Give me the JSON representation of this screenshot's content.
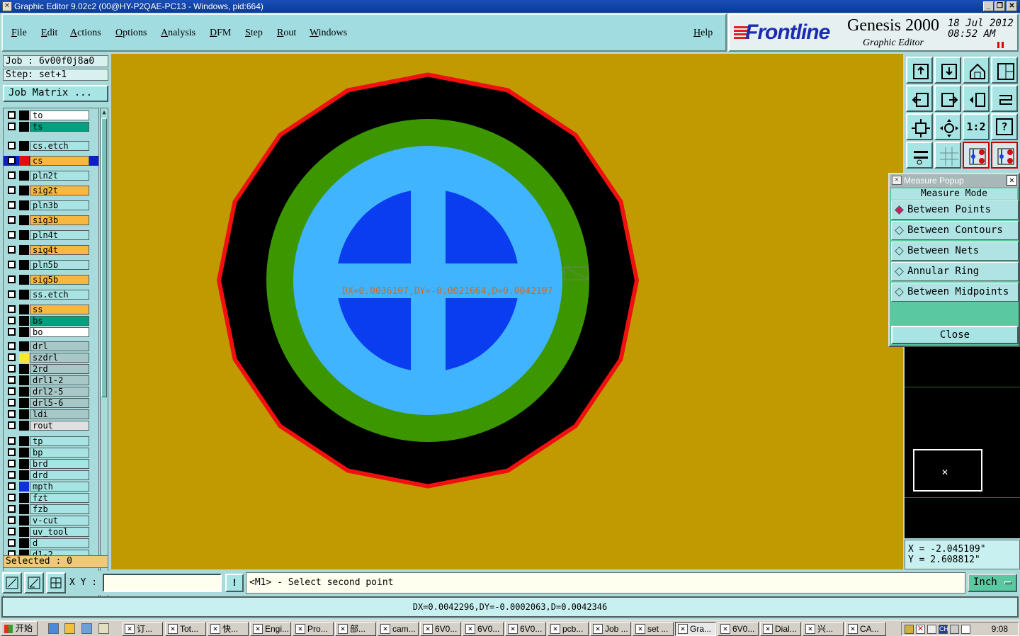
{
  "window": {
    "title": "Graphic Editor 9.02c2 (00@HY-P2QAE-PC13 - Windows, pid:664)",
    "minimize": "_",
    "maximize": "❐",
    "close": "✕"
  },
  "menu": {
    "items": [
      "File",
      "Edit",
      "Actions",
      "Options",
      "Analysis",
      "DFM",
      "Step",
      "Rout",
      "Windows"
    ],
    "help": "Help"
  },
  "brand": {
    "logo": "Frontline",
    "product": "Genesis 2000",
    "subtitle": "Graphic Editor",
    "date": "18 Jul 2012",
    "time": "08:52  AM"
  },
  "left": {
    "job": "Job : 6v00f0j8a0",
    "step": "Step: set+1",
    "job_matrix": "Job Matrix ...",
    "selected": "Selected : 0",
    "layers": [
      {
        "name": "to",
        "color": "#ffffff",
        "swatch": "#000000"
      },
      {
        "name": "ts",
        "color": "#00a080",
        "swatch": "#000000"
      },
      {
        "name": "cs.etch",
        "color": "#a8e4e4",
        "swatch": "#000000"
      },
      {
        "name": "cs",
        "color": "#f8b840",
        "swatch": "#e01010",
        "active": true
      },
      {
        "name": "pln2t",
        "color": "#a8e4e4",
        "swatch": "#000000"
      },
      {
        "name": "sig2t",
        "color": "#f8b840",
        "swatch": "#000000"
      },
      {
        "name": "pln3b",
        "color": "#a8e4e4",
        "swatch": "#000000"
      },
      {
        "name": "sig3b",
        "color": "#f8b840",
        "swatch": "#000000"
      },
      {
        "name": "pln4t",
        "color": "#a8e4e4",
        "swatch": "#000000"
      },
      {
        "name": "sig4t",
        "color": "#f8b840",
        "swatch": "#000000"
      },
      {
        "name": "pln5b",
        "color": "#a8e4e4",
        "swatch": "#000000"
      },
      {
        "name": "sig5b",
        "color": "#f8b840",
        "swatch": "#000000"
      },
      {
        "name": "ss.etch",
        "color": "#a8e4e4",
        "swatch": "#000000"
      },
      {
        "name": "ss",
        "color": "#f8b840",
        "swatch": "#000000"
      },
      {
        "name": "bs",
        "color": "#00a080",
        "swatch": "#000000"
      },
      {
        "name": "bo",
        "color": "#ffffff",
        "swatch": "#000000"
      },
      {
        "name": "drl",
        "color": "#a8c8c8",
        "swatch": "#000000"
      },
      {
        "name": "szdrl",
        "color": "#a8c8c8",
        "swatch": "#f8e830"
      },
      {
        "name": "2rd",
        "color": "#a8c8c8",
        "swatch": "#000000"
      },
      {
        "name": "drl1-2",
        "color": "#a8c8c8",
        "swatch": "#000000"
      },
      {
        "name": "drl2-5",
        "color": "#a8c8c8",
        "swatch": "#000000"
      },
      {
        "name": "drl5-6",
        "color": "#a8c8c8",
        "swatch": "#000000"
      },
      {
        "name": "ldi",
        "color": "#a8c8c8",
        "swatch": "#000000"
      },
      {
        "name": "rout",
        "color": "#e0e0e0",
        "swatch": "#000000"
      },
      {
        "name": "tp",
        "color": "#a8e4e4",
        "swatch": "#000000"
      },
      {
        "name": "bp",
        "color": "#a8e4e4",
        "swatch": "#000000"
      },
      {
        "name": "brd",
        "color": "#a8e4e4",
        "swatch": "#000000"
      },
      {
        "name": "drd",
        "color": "#a8e4e4",
        "swatch": "#000000"
      },
      {
        "name": "mpth",
        "color": "#a8e4e4",
        "swatch": "#1030e0"
      },
      {
        "name": "fzt",
        "color": "#a8e4e4",
        "swatch": "#000000"
      },
      {
        "name": "fzb",
        "color": "#a8e4e4",
        "swatch": "#000000"
      },
      {
        "name": "v-cut",
        "color": "#a8e4e4",
        "swatch": "#000000"
      },
      {
        "name": "uv_tool",
        "color": "#a8e4e4",
        "swatch": "#000000"
      },
      {
        "name": "d",
        "color": "#a8e4e4",
        "swatch": "#000000"
      },
      {
        "name": "d1-2",
        "color": "#a8e4e4",
        "swatch": "#000000"
      }
    ]
  },
  "canvas": {
    "measure_text": "DX=0.0036107,DY=-0.0021664,D=0.0042107",
    "colors": {
      "background": "#c09a00",
      "outline": "#f01010",
      "pad": "#000000",
      "ring": "#3c9600",
      "inner": "#40b4ff",
      "quadrants": "#0a3cf0"
    }
  },
  "toolbar": {
    "buttons": [
      "zoom-home-icon",
      "zoom-back-icon",
      "home-icon",
      "window-icon",
      "pan-left-icon",
      "pan-right-icon",
      "snap-icon",
      "rotate-icon",
      "fit-icon",
      "center-icon",
      "ratio-icon",
      "help-icon",
      "tools-icon",
      "grid-icon",
      "net-icon",
      "net-alt-icon"
    ],
    "ratio_label": "1:2",
    "help_label": "?"
  },
  "measure_popup": {
    "title": "Measure Popup",
    "close_x": "✕",
    "mode_label": "Measure Mode",
    "options": [
      {
        "label": "Between Points",
        "selected": true
      },
      {
        "label": "Between Contours",
        "selected": false
      },
      {
        "label": "Between Nets",
        "selected": false
      },
      {
        "label": "Annular Ring",
        "selected": false
      },
      {
        "label": "Between Midpoints",
        "selected": false
      }
    ],
    "close_button": "Close"
  },
  "coords": {
    "x": "X = -2.045109\"",
    "y": "Y = 2.608812\""
  },
  "bottom": {
    "xy_label": "X Y :",
    "xy_value": "",
    "excl": "!",
    "prompt": "<M1> - Select second point",
    "unit": "Inch",
    "status": "DX=0.0042296,DY=-0.0002063,D=0.0042346"
  },
  "taskbar": {
    "start": "开始",
    "tasks": [
      "订...",
      "Tot...",
      "快...",
      "Engi...",
      "Pro...",
      "部...",
      "cam...",
      "6V0...",
      "6V0...",
      "6V0...",
      "pcb...",
      "Job ...",
      "set ...",
      "Gra...",
      "6V0...",
      "Dial...",
      "兴...",
      "CA..."
    ],
    "active_task": "Gra...",
    "clock": "9:08",
    "lang": "CH"
  }
}
